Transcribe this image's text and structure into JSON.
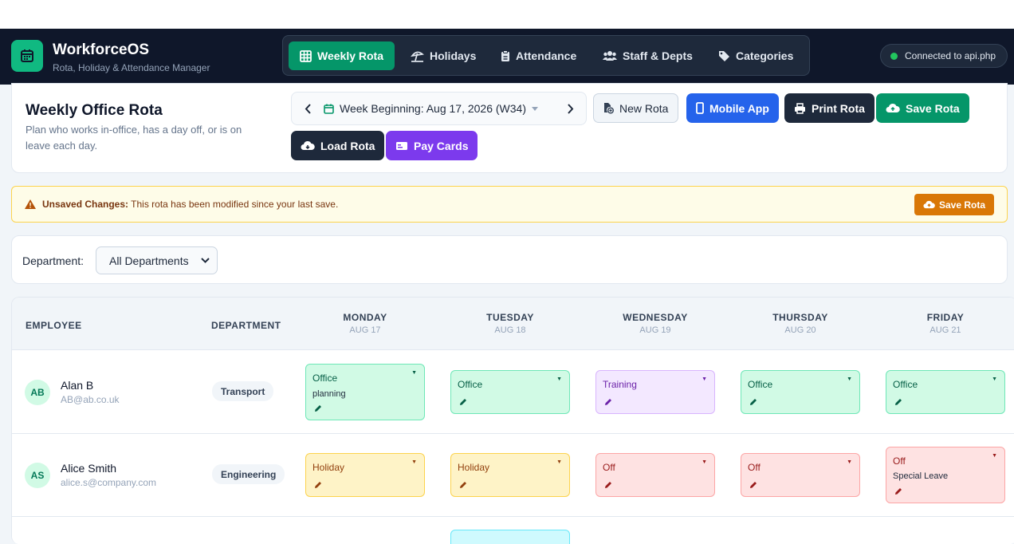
{
  "app": {
    "name": "WorkforceOS",
    "subtitle": "Rota, Holiday & Attendance Manager",
    "connection": "Connected to api.php",
    "status_color": "#22c55e"
  },
  "nav": {
    "tabs": [
      {
        "label": "Weekly Rota",
        "icon": "grid-icon",
        "active": true
      },
      {
        "label": "Holidays",
        "icon": "umbrella-beach-icon",
        "active": false
      },
      {
        "label": "Attendance",
        "icon": "clipboard-icon",
        "active": false
      },
      {
        "label": "Staff & Depts",
        "icon": "users-icon",
        "active": false
      },
      {
        "label": "Categories",
        "icon": "tags-icon",
        "active": false
      }
    ]
  },
  "header": {
    "title": "Weekly Office Rota",
    "description": "Plan who works in-office, has a day off, or is on leave each day.",
    "week_label": "Week Beginning: Aug 17, 2026 (W34)",
    "buttons": {
      "new_rota": "New Rota",
      "mobile_app": "Mobile App",
      "print_rota": "Print Rota",
      "save_rota": "Save Rota",
      "load_rota": "Load Rota",
      "pay_cards": "Pay Cards"
    }
  },
  "alert": {
    "title": "Unsaved Changes:",
    "message": "This rota has been modified since your last save.",
    "button": "Save Rota"
  },
  "filter": {
    "label": "Department:",
    "selected": "All Departments"
  },
  "table": {
    "headers": {
      "employee": "EMPLOYEE",
      "department": "DEPARTMENT"
    },
    "days": [
      {
        "name": "MONDAY",
        "date": "AUG 17"
      },
      {
        "name": "TUESDAY",
        "date": "AUG 18"
      },
      {
        "name": "WEDNESDAY",
        "date": "AUG 19"
      },
      {
        "name": "THURSDAY",
        "date": "AUG 20"
      },
      {
        "name": "FRIDAY",
        "date": "AUG 21"
      }
    ],
    "rows": [
      {
        "initials": "AB",
        "name": "Alan B",
        "email": "AB@ab.co.uk",
        "department": "Transport",
        "cells": [
          {
            "status": "Office",
            "note": "planning"
          },
          {
            "status": "Office",
            "note": ""
          },
          {
            "status": "Training",
            "note": ""
          },
          {
            "status": "Office",
            "note": ""
          },
          {
            "status": "Office",
            "note": ""
          }
        ]
      },
      {
        "initials": "AS",
        "name": "Alice Smith",
        "email": "alice.s@company.com",
        "department": "Engineering",
        "cells": [
          {
            "status": "Holiday",
            "note": ""
          },
          {
            "status": "Holiday",
            "note": ""
          },
          {
            "status": "Off",
            "note": ""
          },
          {
            "status": "Off",
            "note": ""
          },
          {
            "status": "Off",
            "note": "Special Leave"
          }
        ]
      }
    ]
  }
}
